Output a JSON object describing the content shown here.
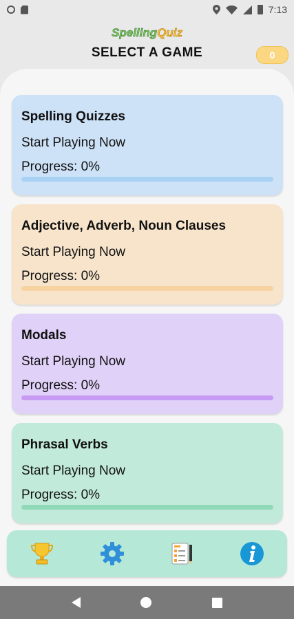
{
  "status_bar": {
    "time": "7:13",
    "icons": [
      "circle-icon",
      "sd-card-icon",
      "location-icon",
      "wifi-icon",
      "signal-icon",
      "battery-icon"
    ]
  },
  "header": {
    "logo_word1": "Spelling",
    "logo_word2": "Quiz",
    "title": "SELECT A GAME",
    "coins": "0"
  },
  "games": [
    {
      "title": "Spelling Quizzes",
      "subtitle": "Start Playing Now",
      "progress_text": "Progress: 0%",
      "progress": 0,
      "color": "#cde2f7"
    },
    {
      "title": "Adjective, Adverb, Noun Clauses",
      "subtitle": "Start Playing Now",
      "progress_text": "Progress: 0%",
      "progress": 0,
      "color": "#f7e4cb"
    },
    {
      "title": "Modals",
      "subtitle": "Start Playing Now",
      "progress_text": "Progress: 0%",
      "progress": 0,
      "color": "#e0d1f8"
    },
    {
      "title": "Phrasal Verbs",
      "subtitle": "Start Playing Now",
      "progress_text": "Progress: 0%",
      "progress": 0,
      "color": "#c2eadb"
    }
  ],
  "toolbar": {
    "icons": [
      "trophy-icon",
      "gear-icon",
      "test-icon",
      "info-icon"
    ]
  },
  "navbar": {
    "icons": [
      "back-icon",
      "home-icon",
      "recents-icon"
    ]
  }
}
